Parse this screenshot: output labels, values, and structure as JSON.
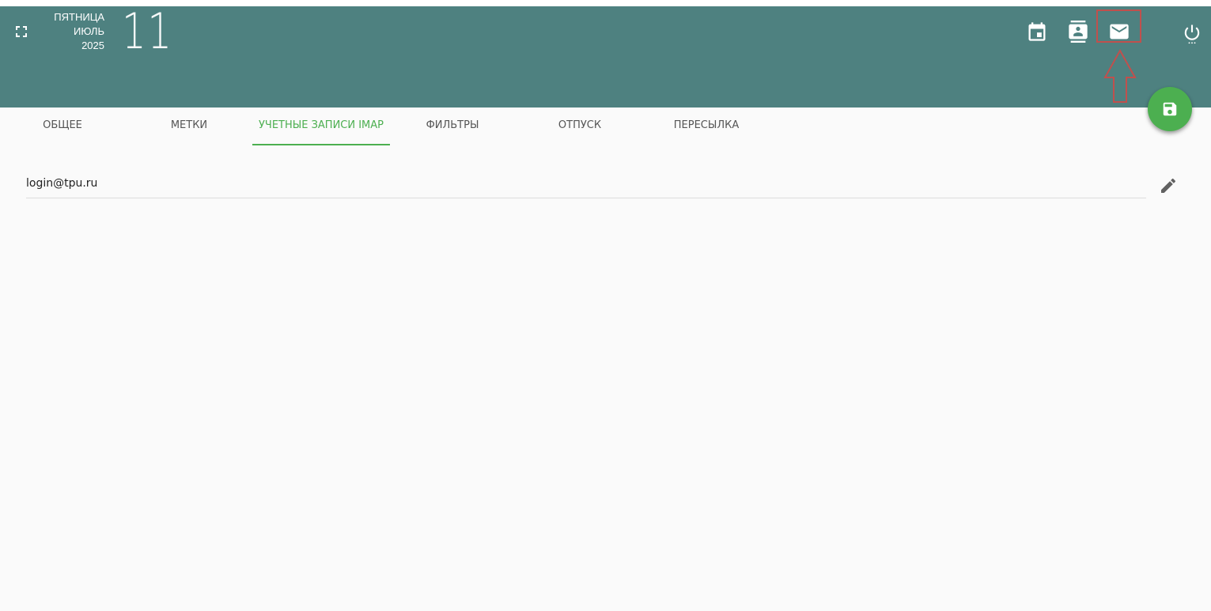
{
  "header": {
    "weekday": "ПЯТНИЦА",
    "month": "ИЮЛЬ",
    "year": "2025",
    "day": "11",
    "background_color": "#4e8180",
    "icons": [
      "fullscreen-icon",
      "calendar-icon",
      "contacts-icon",
      "mail-icon",
      "power-icon"
    ]
  },
  "tabs": [
    {
      "label": "ОБЩЕЕ",
      "active": false
    },
    {
      "label": "МЕТКИ",
      "active": false
    },
    {
      "label": "УЧЕТНЫЕ ЗАПИСИ IMAP",
      "active": true
    },
    {
      "label": "ФИЛЬТРЫ",
      "active": false
    },
    {
      "label": "ОТПУСК",
      "active": false
    },
    {
      "label": "ПЕРЕСЫЛКА",
      "active": false
    }
  ],
  "accounts": [
    {
      "email": "login@tpu.ru"
    }
  ],
  "accent_color": "#4caf50",
  "annotation_color": "#c0504d"
}
